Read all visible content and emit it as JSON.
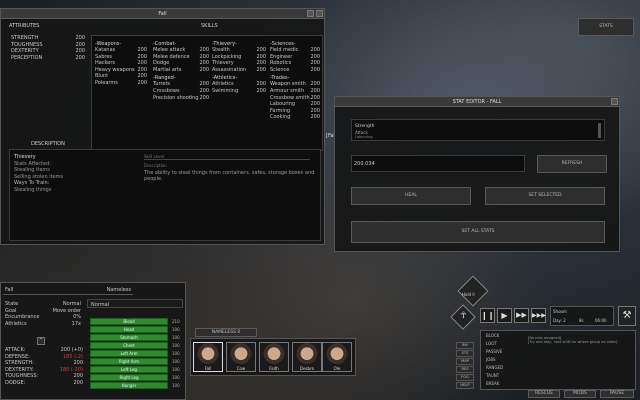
{
  "char_window": {
    "title": "Fall",
    "attributes_header": "ATTRIBUTES",
    "skills_header": "SKILLS",
    "attributes": [
      {
        "name": "STRENGTH",
        "value": "200"
      },
      {
        "name": "TOUGHNESS",
        "value": "200"
      },
      {
        "name": "DEXTERITY",
        "value": "200"
      },
      {
        "name": "PERCEPTION",
        "value": "200"
      }
    ],
    "skills": {
      "weapons": {
        "title": "-Weapons-",
        "items": [
          [
            "Katanas",
            "200"
          ],
          [
            "Sabres",
            "200"
          ],
          [
            "Hackers",
            "200"
          ],
          [
            "Heavy weapons",
            "200"
          ],
          [
            "Blunt",
            "200"
          ],
          [
            "Polearms",
            "200"
          ]
        ]
      },
      "combat": {
        "title": "-Combat-",
        "items": [
          [
            "Melee attack",
            "200"
          ],
          [
            "Melee defence",
            "200"
          ],
          [
            "Dodge",
            "200"
          ],
          [
            "Martial arts",
            "200"
          ]
        ]
      },
      "ranged": {
        "title": "-Ranged-",
        "items": [
          [
            "Turrets",
            "200"
          ],
          [
            "Crossbows",
            "200"
          ],
          [
            "Precision shooting",
            "200"
          ]
        ]
      },
      "thievery": {
        "title": "-Thievery-",
        "items": [
          [
            "Stealth",
            "200"
          ],
          [
            "Lockpicking",
            "200"
          ],
          [
            "Thievery",
            "200"
          ],
          [
            "Assassination",
            "200"
          ]
        ]
      },
      "athletics": {
        "title": "-Athletics-",
        "items": [
          [
            "Athletics",
            "200"
          ],
          [
            "Swimming",
            "200"
          ]
        ]
      },
      "sciences": {
        "title": "-Sciences-",
        "items": [
          [
            "Field medic",
            "200"
          ],
          [
            "Engineer",
            "200"
          ],
          [
            "Robotics",
            "200"
          ],
          [
            "Science",
            "200"
          ]
        ]
      },
      "trades": {
        "title": "-Trades-",
        "items": [
          [
            "Weapon smith",
            "200"
          ],
          [
            "Armour smith",
            "200"
          ],
          [
            "Crossbow smith",
            "200"
          ],
          [
            "Labouring",
            "200"
          ],
          [
            "Farming",
            "200"
          ],
          [
            "Cooking",
            "200"
          ]
        ]
      }
    },
    "description_header": "DESCRIPTION",
    "desc_title": "Thievery",
    "desc_lines": [
      "Stats Affected:",
      "Stealing items",
      "Selling stolen items",
      "Ways To Train:",
      "Stealing things"
    ],
    "desc_right_label1": "Skill Level",
    "desc_right_label2": "Description",
    "desc_text": "The ability to steal things from containers, safes, storage boxes and people."
  },
  "stats_button": "STATS",
  "stat_editor": {
    "title": "STAT EDITOR - FALL",
    "list_items": [
      "Strength",
      "Attack",
      "Labouring"
    ],
    "value": "200.034",
    "refresh": "REFRESH",
    "heal": "HEAL",
    "set_selected": "SET SELECTED",
    "set_all": "SET ALL STATS"
  },
  "fal_label": "[Fal",
  "status_panel": {
    "name": "Fall",
    "faction": "Nameless",
    "rows": [
      [
        "State",
        "Normal"
      ],
      [
        "Goal",
        "Move order"
      ],
      [
        "Encumbrance",
        "0%"
      ],
      [
        "Athletics",
        "17x"
      ]
    ],
    "bottom_stats": [
      [
        "ATTACK:",
        "200 (+0)"
      ],
      [
        "DEFENSE:",
        "185 (-2)"
      ],
      [
        "STRENGTH:",
        "200"
      ],
      [
        "DEXTERITY:",
        "180 (-20)"
      ],
      [
        "TOUGHNESS:",
        "200"
      ],
      [
        "DODGE:",
        "200"
      ]
    ],
    "health_header": "Normal",
    "body_parts": [
      [
        "Blood",
        "210"
      ],
      [
        "Head",
        "100"
      ],
      [
        "Stomach",
        "100"
      ],
      [
        "Chest",
        "100"
      ],
      [
        "Left Arm",
        "100"
      ],
      [
        "Right Arm",
        "100"
      ],
      [
        "Left Leg",
        "100"
      ],
      [
        "Right Leg",
        "100"
      ],
      [
        "Hunger",
        "100"
      ]
    ]
  },
  "squad_tab": "NAMELESS 0",
  "squad": [
    {
      "name": "Fall",
      "selected": true
    },
    {
      "name": "Cow",
      "selected": false
    },
    {
      "name": "Faith",
      "selected": false
    },
    {
      "name": "Desbro",
      "selected": false
    },
    {
      "name": "Ole",
      "selected": false
    }
  ],
  "hold_label": "Hold ll",
  "side_buttons": [
    "INV",
    "STS",
    "MAP",
    "RES",
    "FOG",
    "HELP"
  ],
  "jobs": [
    "BLOCK",
    "LOOT",
    "PASSIVE",
    "JOBS",
    "RANGED",
    "TAUNT",
    "BREAK"
  ],
  "clock": {
    "day": "Day: 2",
    "time": "8s",
    "cats": "06:00",
    "label": "Shoom"
  },
  "bottom_tabs": [
    "RESCUE",
    "MODS",
    "PAUSE"
  ],
  "chat_text": "[No jobs assigned]\n[Try and stay, hold shift for where group as order]",
  "colors": {
    "accent_red": "#c84040",
    "health_green": "#2f8a2f"
  }
}
